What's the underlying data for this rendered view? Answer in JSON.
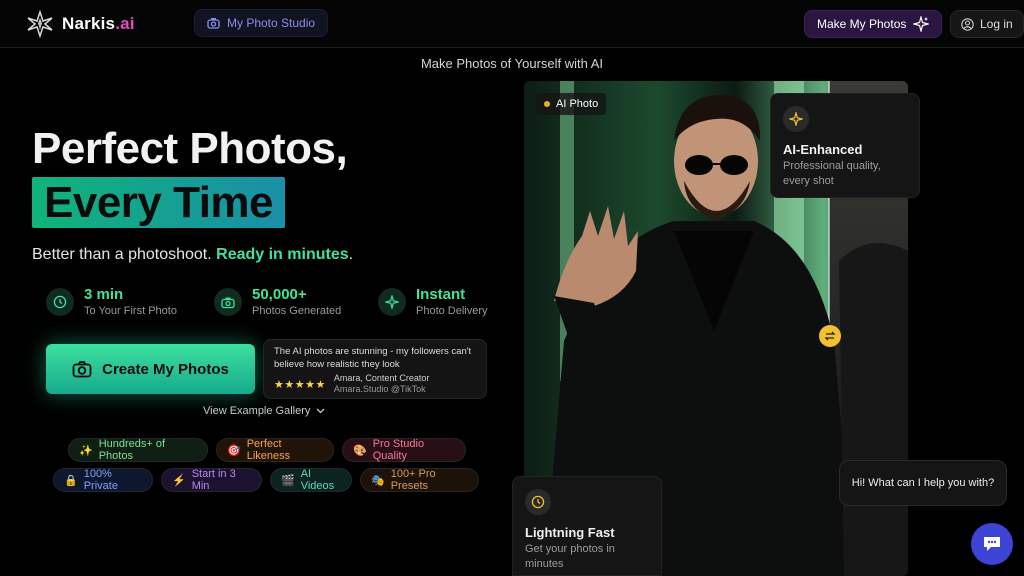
{
  "header": {
    "logo_name": "Narkis",
    "logo_suffix": ".ai",
    "studio_label": "My Photo Studio",
    "make_label": "Make My Photos",
    "login_label": "Log in"
  },
  "subheading": "Make Photos of Yourself with AI",
  "hero": {
    "title_line1": "Perfect Photos,",
    "title_line2": "Every Time",
    "tagline_plain": "Better than a photoshoot. ",
    "tagline_highlight": "Ready in minutes",
    "tagline_end": "."
  },
  "stats": [
    {
      "value": "3 min",
      "label": "To Your First Photo",
      "icon": "clock-icon"
    },
    {
      "value": "50,000+",
      "label": "Photos Generated",
      "icon": "camera-icon"
    },
    {
      "value": "Instant",
      "label": "Photo Delivery",
      "icon": "sparkle-icon"
    }
  ],
  "cta": {
    "label": "Create My Photos"
  },
  "testimonial": {
    "quote": "The AI photos are stunning - my followers can't believe how realistic they look",
    "stars": "★★★★★",
    "name": "Amara, Content Creator",
    "handle": "Amara.Studio @TikTok"
  },
  "gallery_link": "View Example Gallery",
  "chips": [
    {
      "emoji": "✨",
      "label": "Hundreds+ of Photos"
    },
    {
      "emoji": "🎯",
      "label": "Perfect Likeness"
    },
    {
      "emoji": "🎨",
      "label": "Pro Studio Quality"
    },
    {
      "emoji": "🔒",
      "label": "100% Private"
    },
    {
      "emoji": "⚡",
      "label": "Start in 3 Min"
    },
    {
      "emoji": "🎬",
      "label": "AI Videos"
    },
    {
      "emoji": "🎭",
      "label": "100+ Pro Presets"
    }
  ],
  "photo": {
    "badge": "AI Photo"
  },
  "cards": {
    "enhanced_title": "AI-Enhanced",
    "enhanced_desc_1": "Professional quality,",
    "enhanced_desc_2": "every shot",
    "fast_title": "Lightning Fast",
    "fast_desc_1": "Get your photos in",
    "fast_desc_2": "minutes"
  },
  "chat": {
    "greeting": "Hi! What can I help you with?"
  },
  "colors": {
    "accent_green": "#3ee49b",
    "brand_pink": "#e24cc1",
    "studio_blue": "#8a8cf2",
    "chat_blue": "#3c44d6"
  }
}
